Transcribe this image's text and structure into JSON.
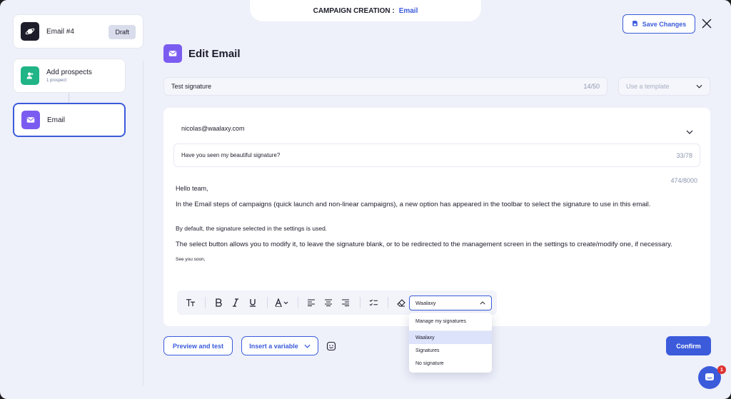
{
  "header": {
    "prefix": "CAMPAIGN CREATION :",
    "accent": "Email"
  },
  "sidebar": {
    "steps": [
      {
        "label": "Email #4",
        "badge": "Draft",
        "icon": "saturn-icon"
      },
      {
        "label": "Add prospects",
        "sub": "1 prospect",
        "icon": "user-add-icon"
      },
      {
        "label": "Email",
        "icon": "envelope-icon"
      }
    ]
  },
  "actions": {
    "save_label": "Save Changes",
    "close_icon": "close-icon"
  },
  "editor": {
    "title": "Edit Email",
    "name_value": "Test signature",
    "name_counter": "14/50",
    "template_placeholder": "Use a template",
    "recipient": "nicolas@waalaxy.com",
    "subject": "Have you seen my beautiful signature?",
    "subject_counter": "33/78",
    "body_counter": "474/8000",
    "body": {
      "greeting": "Hello team,",
      "p1": "In the Email steps of campaigns (quick launch and non-linear campaigns), a new option has appeared in the toolbar to select the signature to use in this email.",
      "p2": "By default, the signature selected in the settings is used.",
      "p3": "The select button allows you to modify it, to leave the signature blank, or to be redirected to the management screen in the settings to create/modify one, if necessary.",
      "closing": "See you soon,"
    }
  },
  "toolbar": {
    "tools": [
      "text-size-icon",
      "bold-icon",
      "italic-icon",
      "underline-icon",
      "font-color-icon",
      "align-left-icon",
      "align-center-icon",
      "align-right-icon",
      "checklist-icon",
      "eraser-icon"
    ],
    "signature_selected": "Waalaxy"
  },
  "signature_dropdown": {
    "manage": "Manage my signatures",
    "options": [
      "Waalaxy",
      "Signatures",
      "No signature"
    ],
    "selected": "Waalaxy"
  },
  "footer": {
    "preview_label": "Preview and test",
    "variable_label": "Insert a variable",
    "confirm_label": "Confirm"
  },
  "chat": {
    "badge": "1"
  },
  "colors": {
    "accent": "#3b5bdb",
    "purple": "#7b5cf0",
    "green": "#20b486",
    "background": "#eef0fa"
  }
}
